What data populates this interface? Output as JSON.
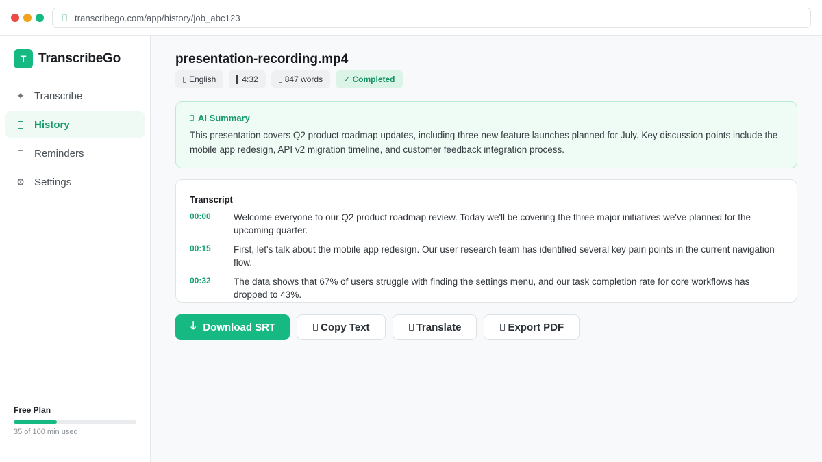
{
  "browser": {
    "url": "transcribego.com/app/history/job_abc123"
  },
  "sidebar": {
    "brand_letter": "T",
    "brand_name": "TranscribeGo",
    "items": [
      {
        "label": "Transcribe",
        "icon": "sparkle-icon",
        "active": false
      },
      {
        "label": "History",
        "icon": "history-icon",
        "active": true
      },
      {
        "label": "Reminders",
        "icon": "bell-icon",
        "active": false
      },
      {
        "label": "Settings",
        "icon": "gear-icon",
        "active": false
      }
    ],
    "plan": {
      "title": "Free Plan",
      "usage_text": "35 of 100 min used",
      "used_fraction": 0.35
    }
  },
  "main": {
    "file_name": "presentation-recording.mp4",
    "meta": {
      "language": "English",
      "duration": "4:32",
      "words": "847 words",
      "status": "✓ Completed"
    },
    "summary": {
      "heading": "AI Summary",
      "text": "This presentation covers Q2 product roadmap updates, including three new feature launches planned for July. Key discussion points include the mobile app redesign, API v2 migration timeline, and customer feedback integration process."
    },
    "transcript": {
      "title": "Transcript",
      "segments": [
        {
          "time": "00:00",
          "text": "Welcome everyone to our Q2 product roadmap review. Today we'll be covering the three major initiatives we've planned for the upcoming quarter."
        },
        {
          "time": "00:15",
          "text": "First, let's talk about the mobile app redesign. Our user research team has identified several key pain points in the current navigation flow."
        },
        {
          "time": "00:32",
          "text": "The data shows that 67% of users struggle with finding the settings menu, and our task completion rate for core workflows has dropped to 43%."
        }
      ]
    },
    "actions": {
      "download": "Download SRT",
      "copy": "Copy Text",
      "translate": "Translate",
      "export": "Export PDF"
    }
  },
  "colors": {
    "accent": "#16b981",
    "accent_dark": "#16996b",
    "summary_bg": "#effcf5"
  }
}
